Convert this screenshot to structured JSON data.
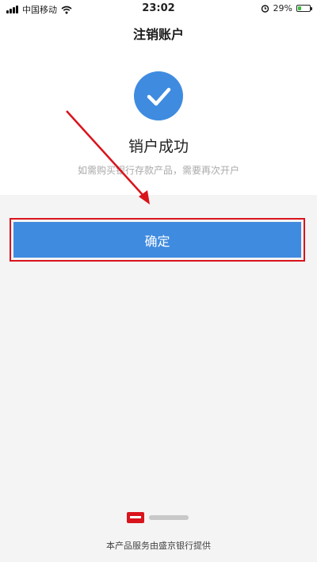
{
  "status_bar": {
    "carrier": "中国移动",
    "time": "23:02",
    "battery": "29%",
    "battery_level": 0.29,
    "icons": [
      "signal-icon",
      "wifi-icon",
      "alarm-icon",
      "battery-icon"
    ]
  },
  "header": {
    "title": "注销账户"
  },
  "result": {
    "icon": "check-icon",
    "title": "销户成功",
    "subtitle": "如需购买银行存款产品，需要再次开户"
  },
  "actions": {
    "confirm_label": "确定"
  },
  "footer": {
    "provider_text": "本产品服务由盛京银行提供"
  },
  "colors": {
    "accent": "#3f8be0",
    "annotation": "#d9141c"
  }
}
